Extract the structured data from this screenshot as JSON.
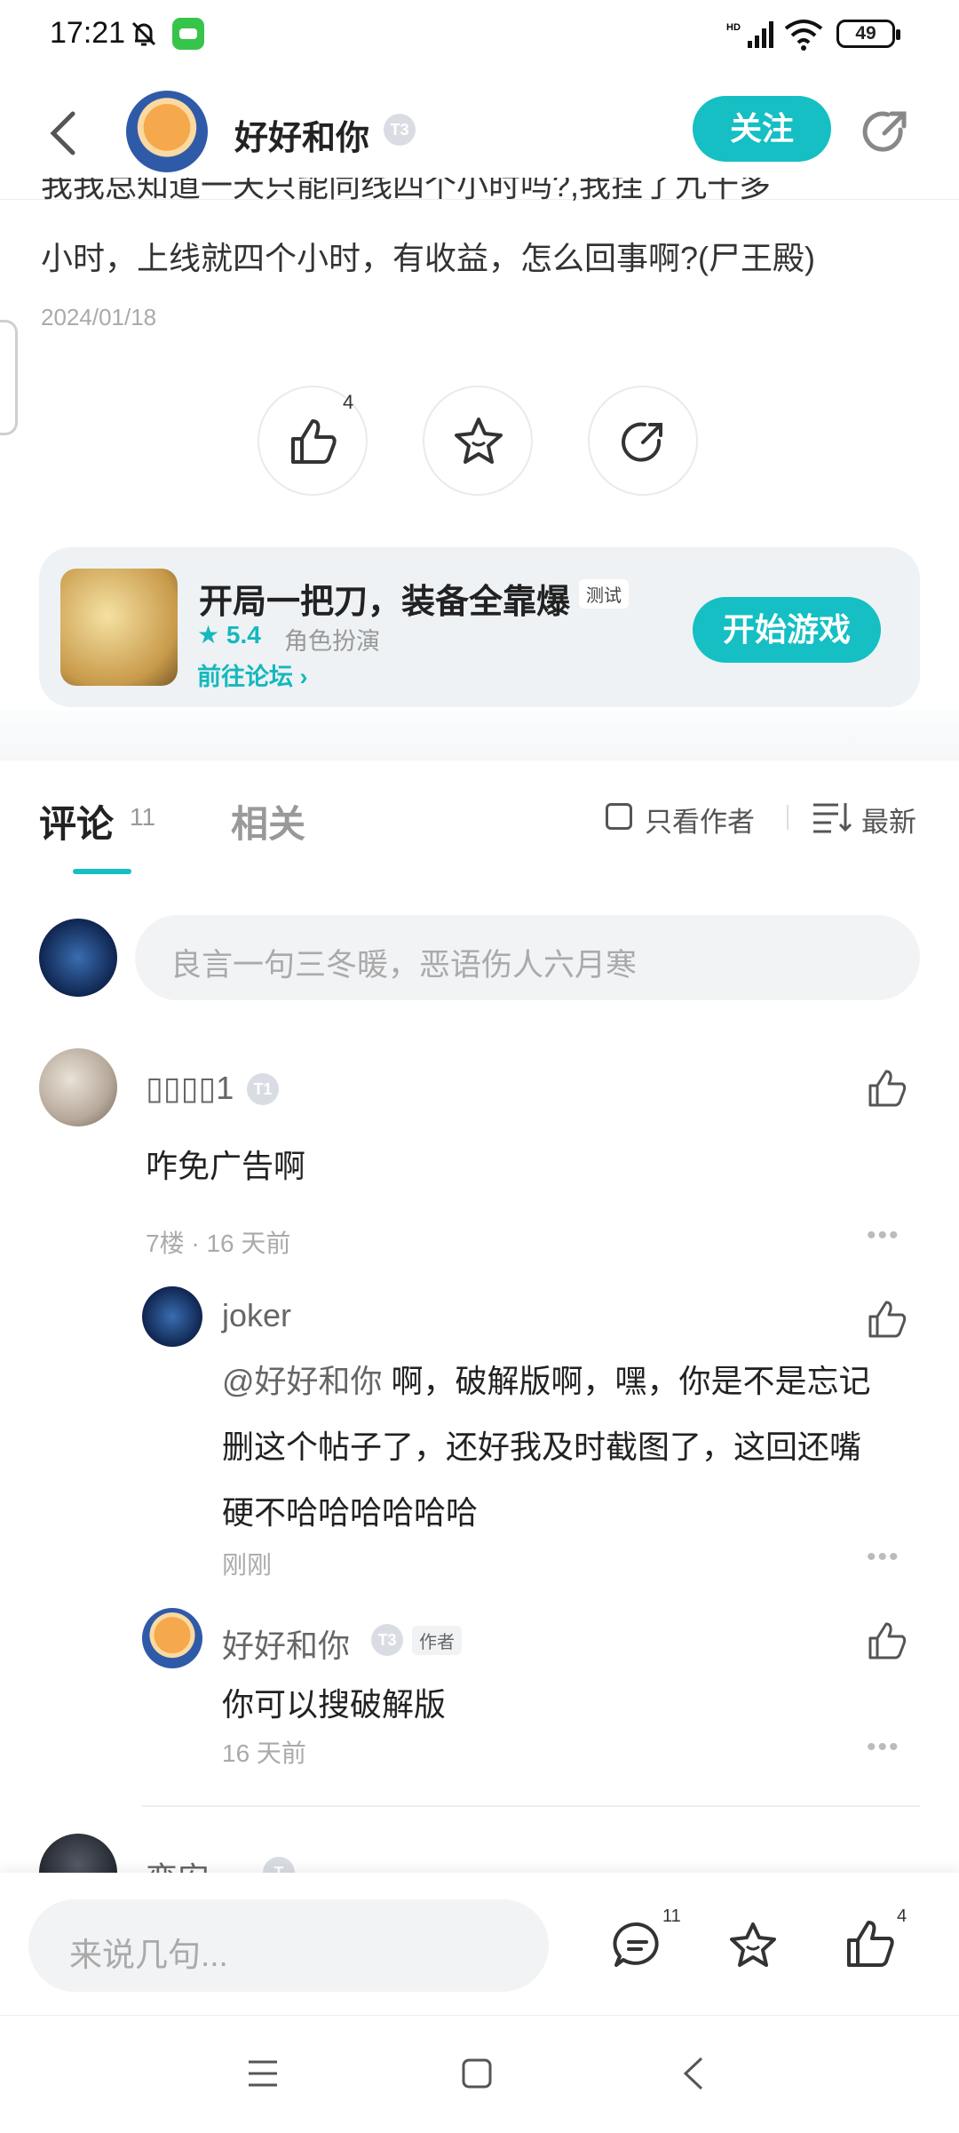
{
  "status_bar": {
    "time": "17:21",
    "battery": "49",
    "network": "HD"
  },
  "header": {
    "username": "好好和你",
    "level": "T3",
    "follow_label": "关注"
  },
  "post": {
    "cut_text": "我我总知道一天只能同线四个小时吗?,我挂了九十多",
    "line": "小时，上线就四个小时，有收益，怎么回事啊?(尸王殿)",
    "date": "2024/01/18",
    "like_count": "4"
  },
  "game_card": {
    "title": "开局一把刀，装备全靠爆",
    "tag": "测试",
    "rating": "★ 5.4",
    "genre": "角色扮演",
    "forum_link": "前往论坛 ›",
    "start_label": "开始游戏"
  },
  "tabs": {
    "comment_label": "评论",
    "comment_count": "11",
    "related_label": "相关",
    "only_author": "只看作者",
    "sort": "最新"
  },
  "comment_input": {
    "placeholder": "良言一句三冬暖，恶语伤人六月寒"
  },
  "comments": [
    {
      "name": "▯▯▯▯1",
      "level": "T1",
      "text": "咋免广告啊",
      "meta": "7楼 · 16 天前"
    },
    {
      "name": "joker",
      "mention": "@好好和你",
      "text_1": " 啊，破解版啊，嘿，你是不是忘记",
      "text_2": "删这个帖子了，还好我及时截图了，这回还嘴",
      "text_3": "硬不哈哈哈哈哈哈",
      "meta": "刚刚"
    },
    {
      "name": "好好和你",
      "level": "T3",
      "author_tag": "作者",
      "text": "你可以搜破解版",
      "meta": "16 天前"
    },
    {
      "name": "变安",
      "level": "T"
    }
  ],
  "bottom_bar": {
    "placeholder": "来说几句...",
    "comment_count": "11",
    "like_count": "4"
  },
  "colors": {
    "accent": "#15bfc4"
  }
}
